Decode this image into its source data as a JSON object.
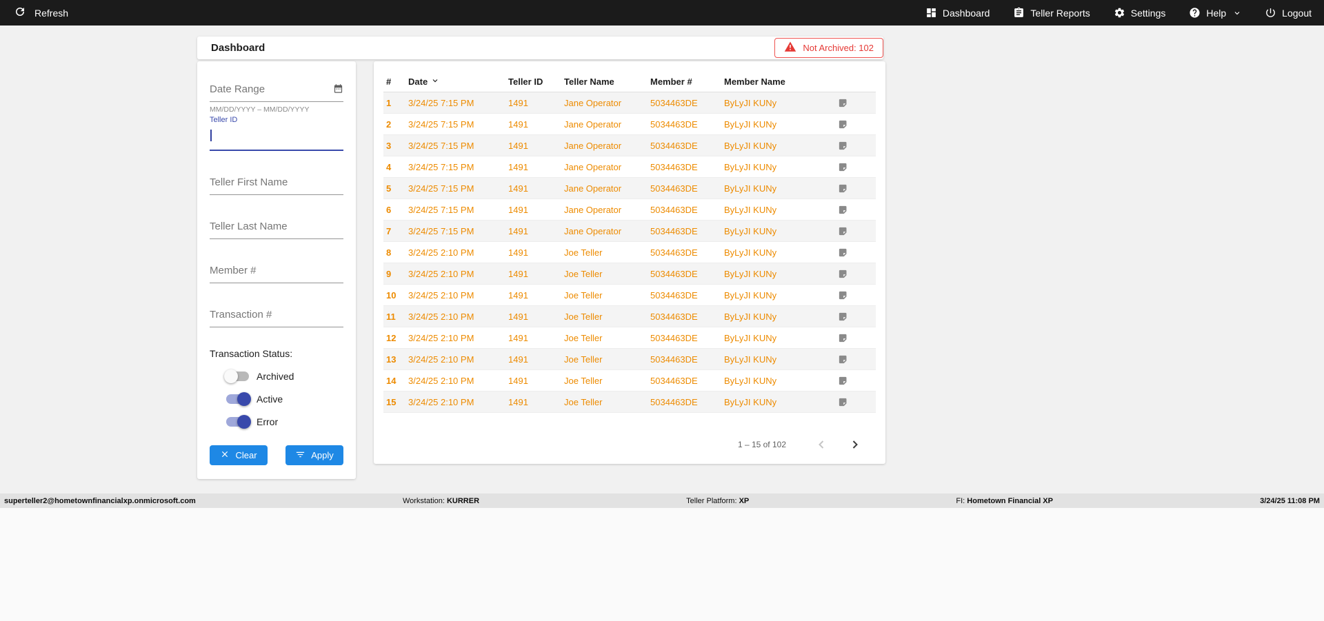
{
  "topbar": {
    "refresh_label": "Refresh",
    "nav": [
      {
        "icon": "dashboard-icon",
        "label": "Dashboard"
      },
      {
        "icon": "teller-reports-icon",
        "label": "Teller Reports"
      },
      {
        "icon": "settings-icon",
        "label": "Settings"
      },
      {
        "icon": "help-icon",
        "label": "Help"
      },
      {
        "icon": "logout-icon",
        "label": "Logout"
      }
    ]
  },
  "header": {
    "title": "Dashboard",
    "not_archived_badge": "Not Archived: 102"
  },
  "filters": {
    "date_range": {
      "placeholder": "Date Range",
      "helper": "MM/DD/YYYY – MM/DD/YYYY"
    },
    "teller_id": {
      "label": "Teller ID",
      "value": ""
    },
    "teller_first_name": {
      "placeholder": "Teller First Name"
    },
    "teller_last_name": {
      "placeholder": "Teller Last Name"
    },
    "member_number": {
      "placeholder": "Member #"
    },
    "transaction_number": {
      "placeholder": "Transaction #"
    },
    "status_label": "Transaction Status:",
    "toggles": [
      {
        "label": "Archived",
        "on": false
      },
      {
        "label": "Active",
        "on": true
      },
      {
        "label": "Error",
        "on": true
      }
    ],
    "clear_label": "Clear",
    "apply_label": "Apply"
  },
  "table": {
    "columns": [
      "#",
      "Date",
      "Teller ID",
      "Teller Name",
      "Member #",
      "Member Name"
    ],
    "sorted_column": "Date",
    "rows": [
      {
        "num": "1",
        "date": "3/24/25 7:15 PM",
        "teller_id": "1491",
        "teller_name": "Jane Operator",
        "member": "5034463DE",
        "member_name": "ByLyJI KUNy"
      },
      {
        "num": "2",
        "date": "3/24/25 7:15 PM",
        "teller_id": "1491",
        "teller_name": "Jane Operator",
        "member": "5034463DE",
        "member_name": "ByLyJI KUNy"
      },
      {
        "num": "3",
        "date": "3/24/25 7:15 PM",
        "teller_id": "1491",
        "teller_name": "Jane Operator",
        "member": "5034463DE",
        "member_name": "ByLyJI KUNy"
      },
      {
        "num": "4",
        "date": "3/24/25 7:15 PM",
        "teller_id": "1491",
        "teller_name": "Jane Operator",
        "member": "5034463DE",
        "member_name": "ByLyJI KUNy"
      },
      {
        "num": "5",
        "date": "3/24/25 7:15 PM",
        "teller_id": "1491",
        "teller_name": "Jane Operator",
        "member": "5034463DE",
        "member_name": "ByLyJI KUNy"
      },
      {
        "num": "6",
        "date": "3/24/25 7:15 PM",
        "teller_id": "1491",
        "teller_name": "Jane Operator",
        "member": "5034463DE",
        "member_name": "ByLyJI KUNy"
      },
      {
        "num": "7",
        "date": "3/24/25 7:15 PM",
        "teller_id": "1491",
        "teller_name": "Jane Operator",
        "member": "5034463DE",
        "member_name": "ByLyJI KUNy"
      },
      {
        "num": "8",
        "date": "3/24/25 2:10 PM",
        "teller_id": "1491",
        "teller_name": "Joe Teller",
        "member": "5034463DE",
        "member_name": "ByLyJI KUNy"
      },
      {
        "num": "9",
        "date": "3/24/25 2:10 PM",
        "teller_id": "1491",
        "teller_name": "Joe Teller",
        "member": "5034463DE",
        "member_name": "ByLyJI KUNy"
      },
      {
        "num": "10",
        "date": "3/24/25 2:10 PM",
        "teller_id": "1491",
        "teller_name": "Joe Teller",
        "member": "5034463DE",
        "member_name": "ByLyJI KUNy"
      },
      {
        "num": "11",
        "date": "3/24/25 2:10 PM",
        "teller_id": "1491",
        "teller_name": "Joe Teller",
        "member": "5034463DE",
        "member_name": "ByLyJI KUNy"
      },
      {
        "num": "12",
        "date": "3/24/25 2:10 PM",
        "teller_id": "1491",
        "teller_name": "Joe Teller",
        "member": "5034463DE",
        "member_name": "ByLyJI KUNy"
      },
      {
        "num": "13",
        "date": "3/24/25 2:10 PM",
        "teller_id": "1491",
        "teller_name": "Joe Teller",
        "member": "5034463DE",
        "member_name": "ByLyJI KUNy"
      },
      {
        "num": "14",
        "date": "3/24/25 2:10 PM",
        "teller_id": "1491",
        "teller_name": "Joe Teller",
        "member": "5034463DE",
        "member_name": "ByLyJI KUNy"
      },
      {
        "num": "15",
        "date": "3/24/25 2:10 PM",
        "teller_id": "1491",
        "teller_name": "Joe Teller",
        "member": "5034463DE",
        "member_name": "ByLyJI KUNy"
      }
    ],
    "pagination": {
      "label": "1 – 15 of 102"
    }
  },
  "footer": {
    "user": "superteller2@hometownfinancialxp.onmicrosoft.com",
    "workstation_label": "Workstation:",
    "workstation_value": "KURRER",
    "platform_label": "Teller Platform:",
    "platform_value": "XP",
    "fi_label": "FI:",
    "fi_value": "Hometown Financial XP",
    "datetime": "3/24/25 11:08 PM"
  },
  "colors": {
    "topbar_bg": "#1b1b1b",
    "accent_blue": "#1e88e5",
    "indigo": "#3949ab",
    "row_text_orange": "#ed8b00",
    "alert_red": "#e53935"
  }
}
